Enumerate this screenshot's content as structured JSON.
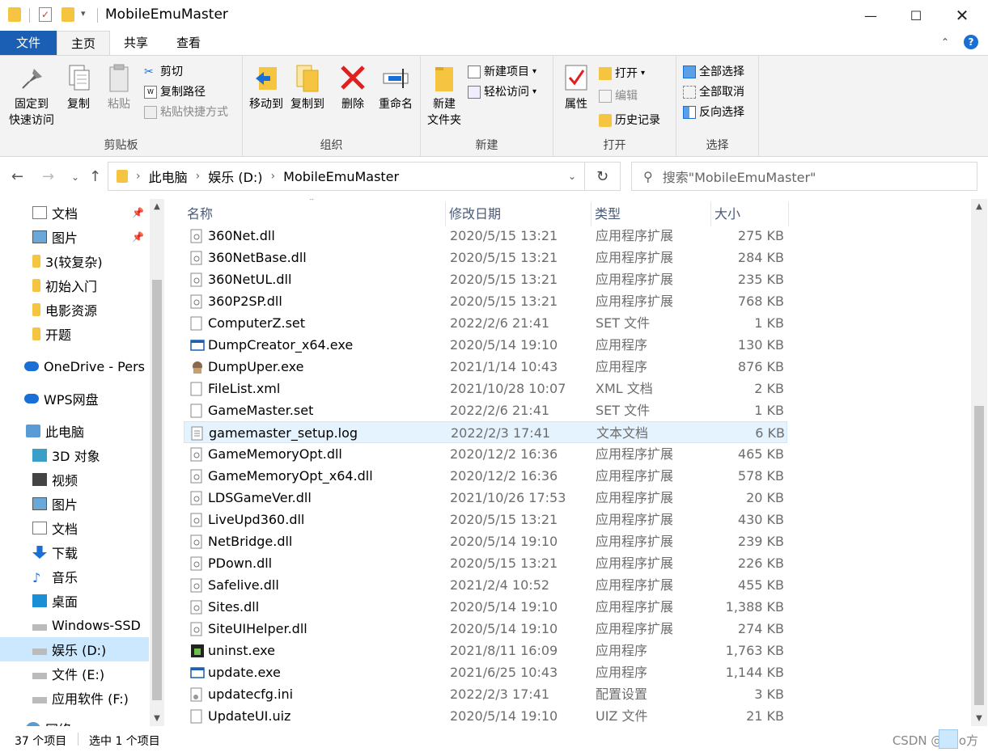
{
  "window": {
    "title": "MobileEmuMaster"
  },
  "ribbon_tabs": {
    "file": "文件",
    "home": "主页",
    "share": "共享",
    "view": "查看"
  },
  "ribbon": {
    "clipboard": {
      "label": "剪贴板",
      "pin": "固定到\n快速访问",
      "copy": "复制",
      "paste": "粘贴",
      "cut": "剪切",
      "copy_path": "复制路径",
      "paste_shortcut": "粘贴快捷方式"
    },
    "organize": {
      "label": "组织",
      "move_to": "移动到",
      "copy_to": "复制到",
      "delete": "删除",
      "rename": "重命名"
    },
    "new": {
      "label": "新建",
      "new_folder": "新建\n文件夹",
      "new_item": "新建项目",
      "easy_access": "轻松访问"
    },
    "open": {
      "label": "打开",
      "properties": "属性",
      "open": "打开",
      "edit": "编辑",
      "history": "历史记录"
    },
    "select": {
      "label": "选择",
      "select_all": "全部选择",
      "select_none": "全部取消",
      "invert": "反向选择"
    }
  },
  "address": {
    "crumbs": [
      "此电脑",
      "娱乐 (D:)",
      "MobileEmuMaster"
    ],
    "search_placeholder": "搜索\"MobileEmuMaster\""
  },
  "nav": {
    "items": [
      {
        "label": "文档",
        "icon": "document-icon",
        "pinned": true
      },
      {
        "label": "图片",
        "icon": "picture-icon",
        "pinned": true
      },
      {
        "label": "3(较复杂)",
        "icon": "folder-icon"
      },
      {
        "label": "初始入门",
        "icon": "folder-icon"
      },
      {
        "label": "电影资源",
        "icon": "folder-icon"
      },
      {
        "label": "开题",
        "icon": "folder-icon"
      },
      {
        "label": "OneDrive - Pers",
        "icon": "cloud-icon"
      },
      {
        "label": "WPS网盘",
        "icon": "cloud-icon"
      },
      {
        "label": "此电脑",
        "icon": "computer-icon"
      },
      {
        "label": "3D 对象",
        "icon": "cube-icon"
      },
      {
        "label": "视频",
        "icon": "video-icon"
      },
      {
        "label": "图片",
        "icon": "picture-icon"
      },
      {
        "label": "文档",
        "icon": "document-icon"
      },
      {
        "label": "下载",
        "icon": "download-icon"
      },
      {
        "label": "音乐",
        "icon": "music-icon"
      },
      {
        "label": "桌面",
        "icon": "desktop-icon"
      },
      {
        "label": "Windows-SSD",
        "icon": "drive-icon"
      },
      {
        "label": "娱乐 (D:)",
        "icon": "drive-icon",
        "selected": true
      },
      {
        "label": "文件 (E:)",
        "icon": "drive-icon"
      },
      {
        "label": "应用软件 (F:)",
        "icon": "drive-icon"
      },
      {
        "label": "网络",
        "icon": "network-icon"
      }
    ]
  },
  "columns": {
    "name": "名称",
    "modified": "修改日期",
    "type": "类型",
    "size": "大小"
  },
  "files": [
    {
      "name": "360Net.dll",
      "date": "2020/5/15 13:21",
      "type": "应用程序扩展",
      "size": "275 KB",
      "icon": "dll-icon"
    },
    {
      "name": "360NetBase.dll",
      "date": "2020/5/15 13:21",
      "type": "应用程序扩展",
      "size": "284 KB",
      "icon": "dll-icon"
    },
    {
      "name": "360NetUL.dll",
      "date": "2020/5/15 13:21",
      "type": "应用程序扩展",
      "size": "235 KB",
      "icon": "dll-icon"
    },
    {
      "name": "360P2SP.dll",
      "date": "2020/5/15 13:21",
      "type": "应用程序扩展",
      "size": "768 KB",
      "icon": "dll-icon"
    },
    {
      "name": "ComputerZ.set",
      "date": "2022/2/6 21:41",
      "type": "SET 文件",
      "size": "1 KB",
      "icon": "file-icon"
    },
    {
      "name": "DumpCreator_x64.exe",
      "date": "2020/5/14 19:10",
      "type": "应用程序",
      "size": "130 KB",
      "icon": "window-exe-icon"
    },
    {
      "name": "DumpUper.exe",
      "date": "2021/1/14 10:43",
      "type": "应用程序",
      "size": "876 KB",
      "icon": "app-exe-icon"
    },
    {
      "name": "FileList.xml",
      "date": "2021/10/28 10:07",
      "type": "XML 文档",
      "size": "2 KB",
      "icon": "file-icon"
    },
    {
      "name": "GameMaster.set",
      "date": "2022/2/6 21:41",
      "type": "SET 文件",
      "size": "1 KB",
      "icon": "file-icon"
    },
    {
      "name": "gamemaster_setup.log",
      "date": "2022/2/3 17:41",
      "type": "文本文档",
      "size": "6 KB",
      "icon": "text-file-icon",
      "selected": true
    },
    {
      "name": "GameMemoryOpt.dll",
      "date": "2020/12/2 16:36",
      "type": "应用程序扩展",
      "size": "465 KB",
      "icon": "dll-icon"
    },
    {
      "name": "GameMemoryOpt_x64.dll",
      "date": "2020/12/2 16:36",
      "type": "应用程序扩展",
      "size": "578 KB",
      "icon": "dll-icon"
    },
    {
      "name": "LDSGameVer.dll",
      "date": "2021/10/26 17:53",
      "type": "应用程序扩展",
      "size": "20 KB",
      "icon": "dll-icon"
    },
    {
      "name": "LiveUpd360.dll",
      "date": "2020/5/15 13:21",
      "type": "应用程序扩展",
      "size": "430 KB",
      "icon": "dll-icon"
    },
    {
      "name": "NetBridge.dll",
      "date": "2020/5/14 19:10",
      "type": "应用程序扩展",
      "size": "239 KB",
      "icon": "dll-icon"
    },
    {
      "name": "PDown.dll",
      "date": "2020/5/15 13:21",
      "type": "应用程序扩展",
      "size": "226 KB",
      "icon": "dll-icon"
    },
    {
      "name": "Safelive.dll",
      "date": "2021/2/4 10:52",
      "type": "应用程序扩展",
      "size": "455 KB",
      "icon": "dll-icon"
    },
    {
      "name": "Sites.dll",
      "date": "2020/5/14 19:10",
      "type": "应用程序扩展",
      "size": "1,388 KB",
      "icon": "dll-icon"
    },
    {
      "name": "SiteUIHelper.dll",
      "date": "2020/5/14 19:10",
      "type": "应用程序扩展",
      "size": "274 KB",
      "icon": "dll-icon"
    },
    {
      "name": "uninst.exe",
      "date": "2021/8/11 16:09",
      "type": "应用程序",
      "size": "1,763 KB",
      "icon": "uninstall-exe-icon"
    },
    {
      "name": "update.exe",
      "date": "2021/6/25 10:43",
      "type": "应用程序",
      "size": "1,144 KB",
      "icon": "window-exe-icon"
    },
    {
      "name": "updatecfg.ini",
      "date": "2022/2/3 17:41",
      "type": "配置设置",
      "size": "3 KB",
      "icon": "ini-icon"
    },
    {
      "name": "UpdateUI.uiz",
      "date": "2020/5/14 19:10",
      "type": "UIZ 文件",
      "size": "21 KB",
      "icon": "file-icon"
    }
  ],
  "status": {
    "count": "37 个项目",
    "selected": "选中 1 个项目",
    "watermark": "CSDN @Zoo方"
  },
  "colors": {
    "accent": "#1a5fb4",
    "selection": "#cce8ff",
    "folder": "#f5c542"
  }
}
